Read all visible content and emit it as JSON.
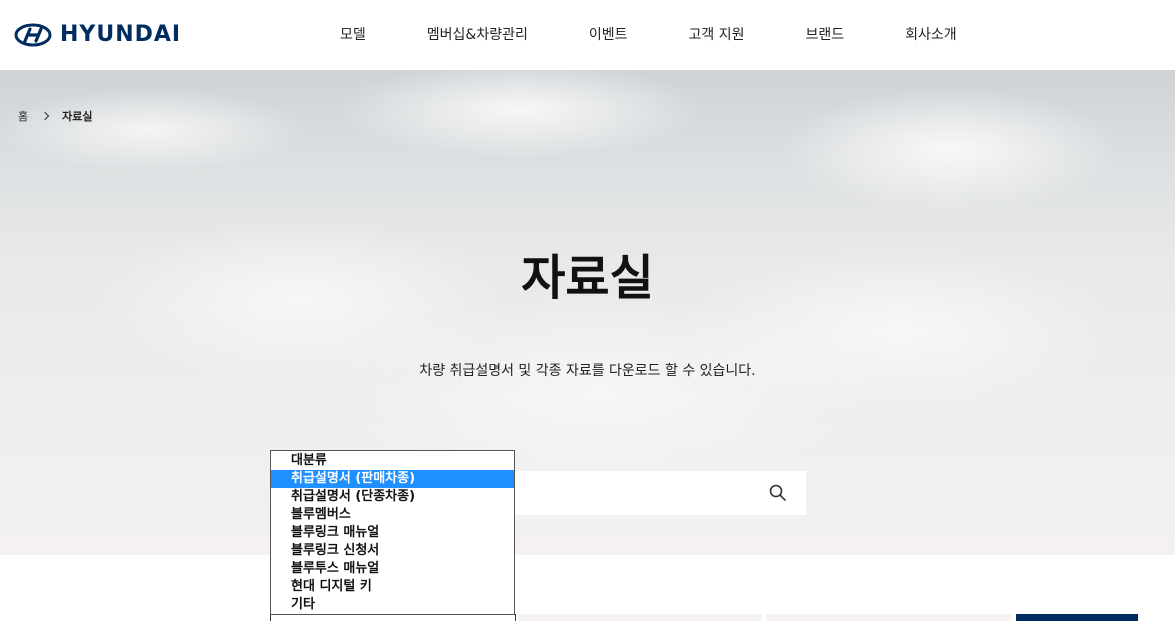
{
  "header": {
    "brand": "HYUNDAI",
    "nav": [
      "모델",
      "멤버십&차량관리",
      "이벤트",
      "고객 지원",
      "브랜드",
      "회사소개"
    ]
  },
  "breadcrumb": {
    "home": "홈",
    "current": "자료실"
  },
  "hero": {
    "title": "자료실",
    "description": "차량 취급설명서 및 각종 자료를 다운로드 할 수 있습니다."
  },
  "category_select": {
    "options": [
      "대분류",
      "취급설명서 (판매차종)",
      "취급설명서 (단종차종)",
      "블루멤버스",
      "블루링크 매뉴얼",
      "블루링크 신청서",
      "블루투스 매뉴얼",
      "현대 디지털 키",
      "기타"
    ],
    "highlighted_index": 1
  },
  "search": {
    "icon": "search-icon"
  },
  "colors": {
    "brand": "#002c5f",
    "highlight": "#1e90ff"
  }
}
